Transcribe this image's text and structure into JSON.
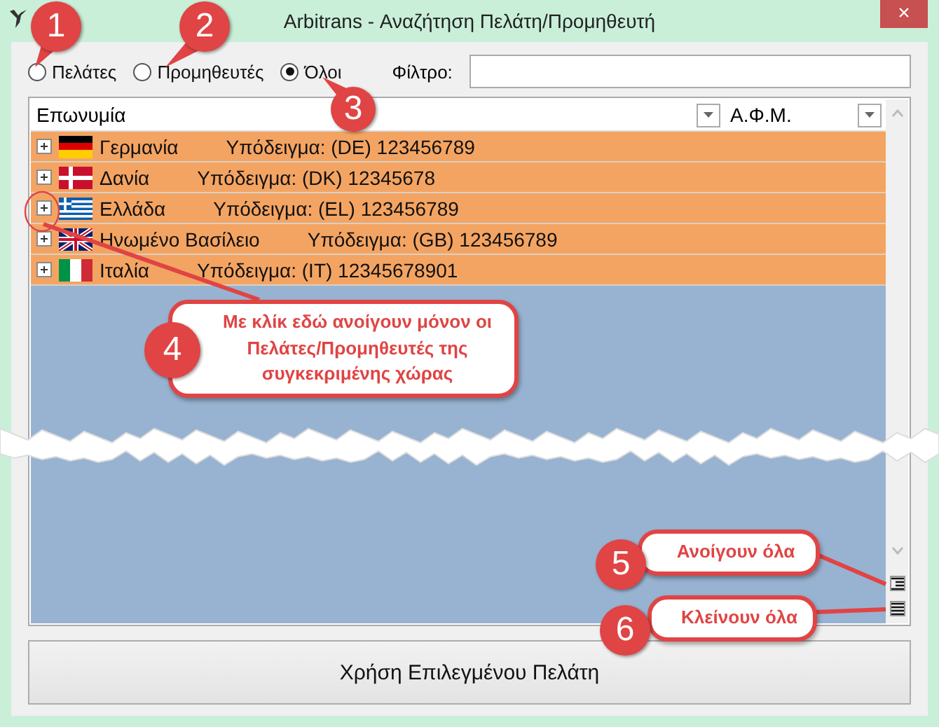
{
  "window": {
    "title": "Arbitrans - Αναζήτηση Πελάτη/Προμηθευτή",
    "close": "×"
  },
  "filters": [
    {
      "label": "Πελάτες",
      "selected": false
    },
    {
      "label": "Προμηθευτές",
      "selected": false
    },
    {
      "label": "Όλοι",
      "selected": true
    }
  ],
  "filter_field": {
    "label": "Φίλτρο:"
  },
  "table": {
    "columns": [
      "Επωνυμία",
      "Α.Φ.Μ."
    ],
    "rows": [
      {
        "name": "Γερμανία",
        "sample": "Υπόδειγμα: (DE) 123456789"
      },
      {
        "name": "Δανία",
        "sample": "Υπόδειγμα: (DK) 12345678"
      },
      {
        "name": "Ελλάδα",
        "sample": "Υπόδειγμα: (EL) 123456789"
      },
      {
        "name": "Ηνωμένο Βασίλειο",
        "sample": "Υπόδειγμα: (GB) 123456789"
      },
      {
        "name": "Ιταλία",
        "sample": "Υπόδειγμα: (IT) 12345678901"
      }
    ]
  },
  "button": "Χρήση Επιλεγμένου Πελάτη",
  "annotations": [
    {
      "number": "1"
    },
    {
      "number": "2"
    },
    {
      "number": "3"
    },
    {
      "number": "4",
      "text": "Με κλίκ εδώ ανοίγουν μόνον οι Πελάτες/Προμηθευτές της συγκεκριμένης χώρας"
    },
    {
      "number": "5",
      "text": "Ανοίγουν όλα"
    },
    {
      "number": "6",
      "text": "Κλείνουν όλα"
    }
  ]
}
